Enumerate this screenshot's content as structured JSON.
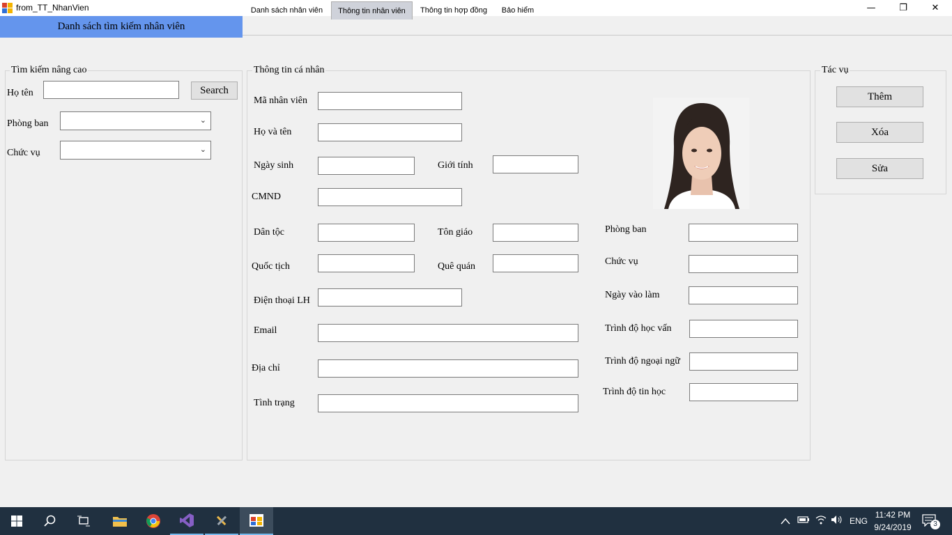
{
  "window": {
    "title": "from_TT_NhanVien",
    "minimize_glyph": "—",
    "restore_glyph": "❐",
    "close_glyph": "✕"
  },
  "header": {
    "list_label": "Danh sách tìm kiếm nhân viên"
  },
  "tabs": [
    {
      "label": "Danh sách nhân viên"
    },
    {
      "label": "Thông tin nhân viên",
      "active": true
    },
    {
      "label": "Thông tin hợp đồng"
    },
    {
      "label": "Bảo hiểm"
    }
  ],
  "search_panel": {
    "title": "Tìm kiếm nâng cao",
    "name_label": "Họ tên",
    "name_value": "",
    "search_button": "Search",
    "department_label": "Phòng ban",
    "department_value": "",
    "position_label": "Chức vụ",
    "position_value": ""
  },
  "personal_info": {
    "title": "Thông tin cá nhân",
    "employee_id_label": "Mã nhân viên",
    "full_name_label": "Họ và tên",
    "birth_date_label": "Ngày sinh",
    "gender_label": "Giới tính",
    "id_card_label": "CMND",
    "ethnicity_label": "Dân tộc",
    "religion_label": "Tôn giáo",
    "nationality_label": "Quốc tịch",
    "hometown_label": "Quê quán",
    "phone_label": "Điện thoại LH",
    "email_label": "Email",
    "address_label": "Địa chỉ",
    "status_label": "Tình trạng",
    "department_label": "Phòng ban",
    "position_label": "Chức vụ",
    "start_date_label": "Ngày vào làm",
    "education_label": "Trình độ học vấn",
    "language_label": "Trình độ ngoại ngữ",
    "it_label": "Trình độ tin học"
  },
  "actions": {
    "title": "Tác vụ",
    "add_button": "Thêm",
    "delete_button": "Xóa",
    "edit_button": "Sửa"
  },
  "taskbar": {
    "icons": [
      "windows-start-icon",
      "search-icon",
      "task-view-icon",
      "file-explorer-icon",
      "chrome-icon",
      "visual-studio-icon",
      "tools-icon",
      "app-form-icon"
    ],
    "language": "ENG",
    "time": "11:42 PM",
    "date": "9/24/2019",
    "notification_count": "3",
    "colors": {
      "background": "#203040",
      "accent": "#6495ed"
    }
  }
}
